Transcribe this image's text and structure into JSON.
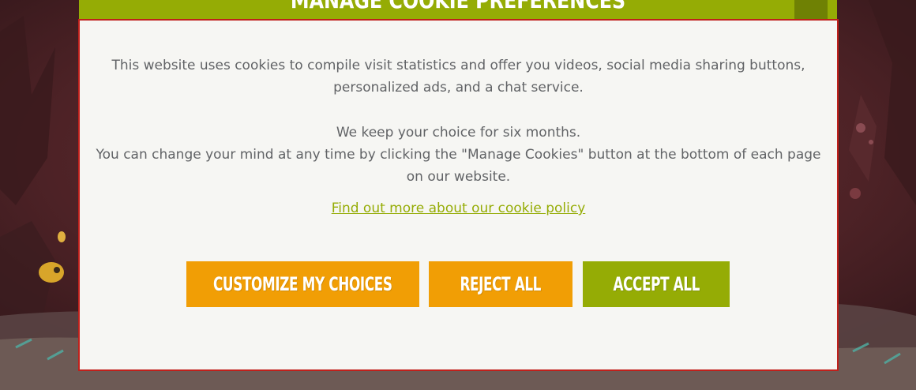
{
  "modal": {
    "title": "MANAGE COOKIE PREFERENCES",
    "paragraph1": "This website uses cookies to compile visit statistics and offer you videos, social media sharing buttons, personalized ads, and a chat service.",
    "paragraph2_line1": "We keep your choice for six months.",
    "paragraph2_line2": "You can change your mind at any time by clicking the \"Manage Cookies\" button at the bottom of each page on our website.",
    "policy_link": "Find out more about our cookie policy",
    "buttons": {
      "customize": "CUSTOMIZE MY CHOICES",
      "reject": "REJECT ALL",
      "accept": "ACCEPT ALL"
    }
  },
  "colors": {
    "accent_green": "#95ac05",
    "accent_orange": "#f19e05",
    "modal_border": "#c0201b",
    "modal_background": "#f6f6f3",
    "body_text": "#616366"
  }
}
